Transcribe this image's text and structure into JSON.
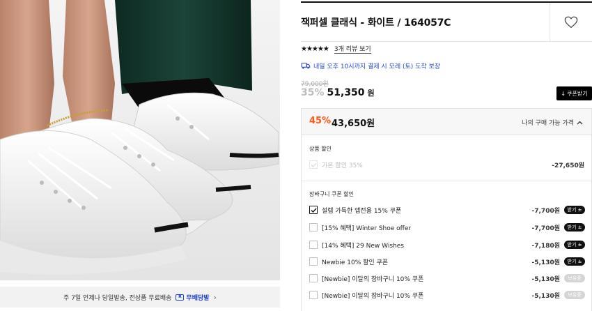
{
  "product": {
    "title": "잭퍼셀 클래식 - 화이트 / 164057C",
    "stars": "★★★★★",
    "review_link": "3개 리뷰 보기",
    "delivery_text": "내일 오후 10시까지 결제 시 모레 (토) 도착 보장",
    "original_price": "79,000원",
    "discount_rate": "35%",
    "sale_price": "51,350",
    "sale_unit": "원",
    "coupon_button": "쿠폰받기",
    "favorite_icon": "heart-icon"
  },
  "shipping_bar": {
    "text": "주 7일 언제나 당일발송, 전상품 무료배송",
    "badge": "무배당발",
    "badge_icon": "R"
  },
  "my_price": {
    "rate": "45%",
    "price": "43,650원",
    "toggle_label": "나의 구매 가능 가격"
  },
  "product_discount": {
    "title": "상품 할인",
    "items": [
      {
        "label": "기본 할인 35%",
        "amount": "-27,650원"
      }
    ]
  },
  "cart_coupons": {
    "title": "장바구니 쿠폰 할인",
    "items": [
      {
        "label": "설렘 가득한 앱전용 15% 쿠폰",
        "amount": "-7,700원",
        "button": "받기 ±"
      },
      {
        "label": "[15% 혜택] Winter Shoe offer",
        "amount": "-7,700원",
        "button": "받기 ±"
      },
      {
        "label": "[14% 혜택] 29 New Wishes",
        "amount": "-7,180원",
        "button": "받기 ±"
      },
      {
        "label": "Newbie 10% 할인 쿠폰",
        "amount": "-5,130원",
        "button": "받기 ±"
      },
      {
        "label": "[Newbie] 이달의 장바구니 10% 쿠폰",
        "amount": "-5,130원",
        "button": "보유중"
      },
      {
        "label": "[Newbie] 이달의 장바구니 10% 쿠폰",
        "amount": "-5,130원",
        "button": "보유중"
      }
    ]
  },
  "colors": {
    "accent_orange": "#ff5a14",
    "delivery_blue": "#2447d6",
    "coupon_button_bg": "#000000"
  }
}
